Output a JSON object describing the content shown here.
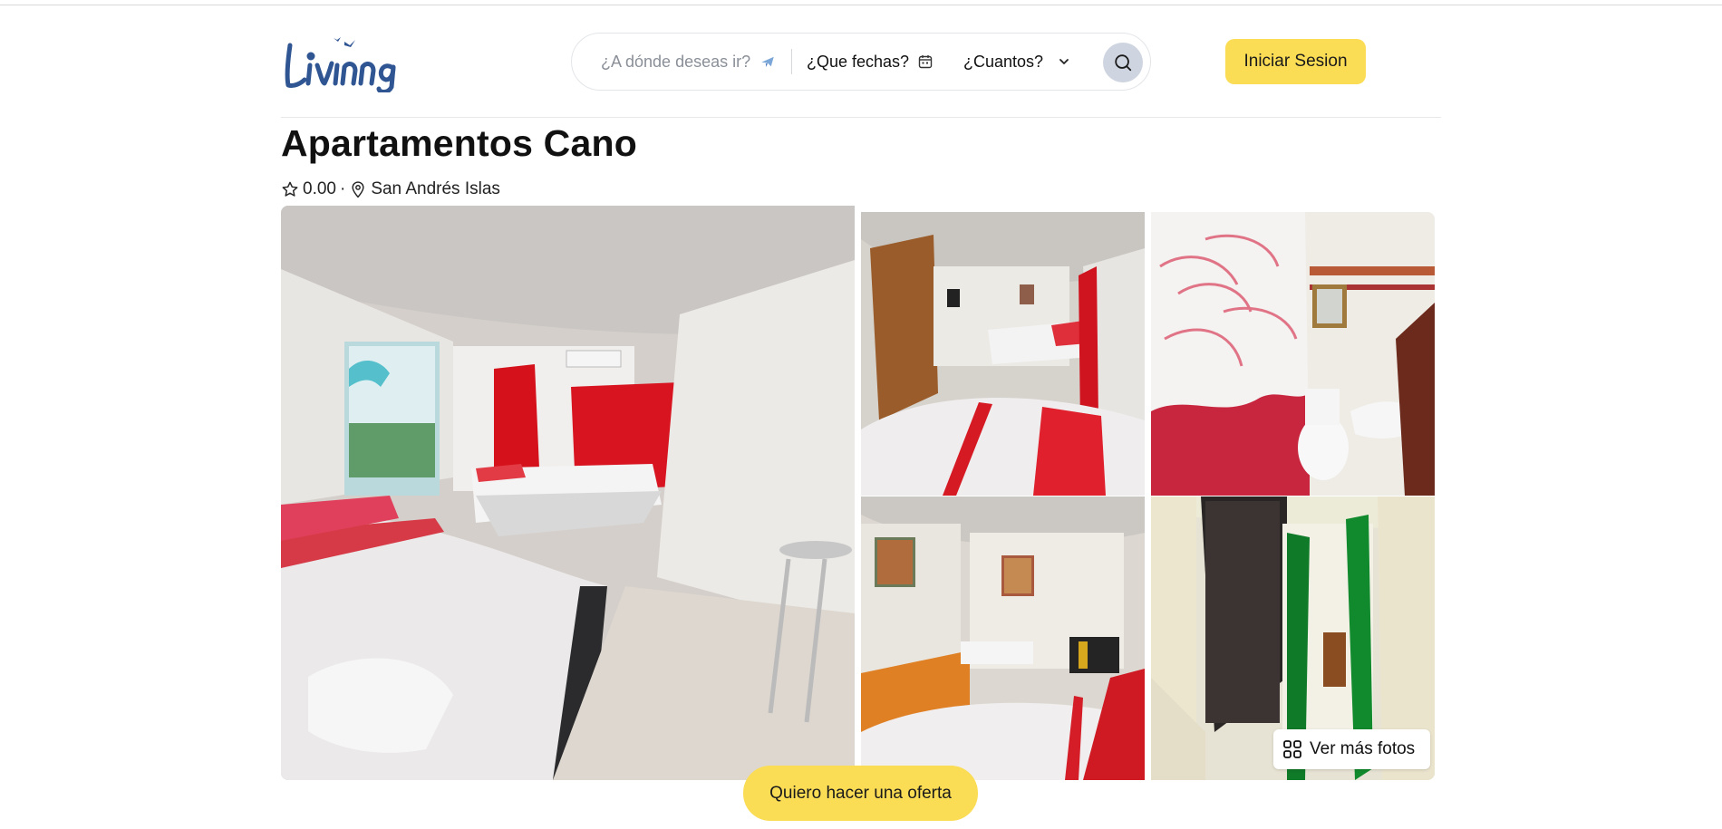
{
  "header": {
    "logo_alt": "Livinng",
    "search": {
      "where_placeholder": "¿A dónde deseas ir?",
      "dates_label": "¿Que fechas?",
      "guests_label": "¿Cuantos?"
    },
    "login_label": "Iniciar Sesion"
  },
  "listing": {
    "title": "Apartamentos Cano",
    "rating": "0.00",
    "separator": "·",
    "location": "San Andrés Islas"
  },
  "gallery": {
    "more_photos_label": "Ver más fotos"
  },
  "offer_label": "Quiero hacer una oferta",
  "colors": {
    "accent": "#fbdc55",
    "logo": "#2f5593",
    "search_btn": "#cfd5e0"
  }
}
